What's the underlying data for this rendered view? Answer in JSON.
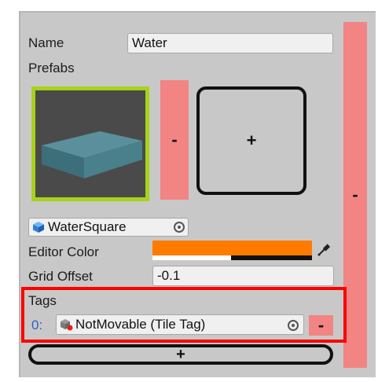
{
  "name": {
    "label": "Name",
    "value": "Water"
  },
  "prefabs": {
    "label": "Prefabs",
    "remove_label": "-",
    "add_label": "+",
    "selected_object": "WaterSquare"
  },
  "editor_color": {
    "label": "Editor Color",
    "color": "#ff7b00"
  },
  "grid_offset": {
    "label": "Grid Offset",
    "value": "-0.1"
  },
  "tags": {
    "label": "Tags",
    "items": [
      {
        "index": "0:",
        "value": "NotMovable (Tile Tag)"
      }
    ],
    "remove_label": "-",
    "add_label": "+"
  },
  "side_remove_label": "-",
  "colors": {
    "highlight_red": "#ff0000",
    "preview_border": "#a8d21a",
    "remove_button": "#f28484",
    "panel": "#c8c8c8"
  }
}
